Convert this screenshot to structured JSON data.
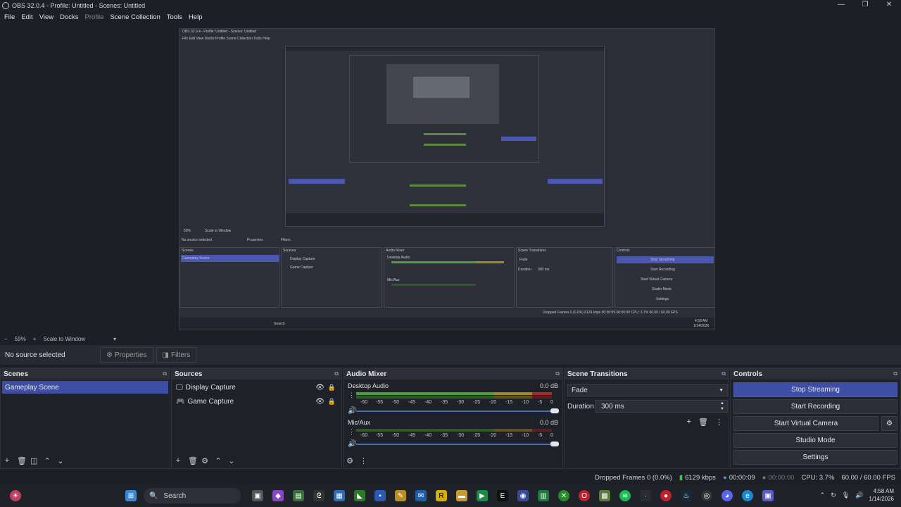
{
  "window": {
    "title": "OBS 32.0.4 - Profile: Untitled - Scenes: Untitled",
    "minimize": "—",
    "maximize": "❐",
    "close": "✕"
  },
  "menu": [
    "File",
    "Edit",
    "View",
    "Docks",
    "Profile",
    "Scene Collection",
    "Tools",
    "Help"
  ],
  "nested_preview": {
    "title": "OBS 32.0.4 - Profile: Untitled - Scenes: Untitled",
    "menu": "File  Edit  View  Docks  Profile  Scene Collection  Tools  Help",
    "zoom": "59%",
    "scale": "Scale to Window",
    "no_source": "No source selected",
    "properties": "Properties",
    "filters": "Filters",
    "scenes": "Scenes",
    "sources": "Sources",
    "audio_mixer": "Audio Mixer",
    "scene_transitions": "Scene Transitions",
    "controls": "Controls",
    "scene_item": "Gameplay Scene",
    "source1": "Display Capture",
    "source2": "Game Capture",
    "desktop_audio": "Desktop Audio",
    "mic": "Mic/Aux",
    "fade": "Fade",
    "duration": "Duration",
    "duration_val": "300 ms",
    "stop_streaming": "Stop Streaming",
    "start_recording": "Start Recording",
    "start_virtual": "Start Virtual Camera",
    "studio": "Studio Mode",
    "settings": "Settings",
    "status": "Dropped Frames 0 (0.0%)   6129 kbps   00:00:09   00:00:00   CPU: 3.7%   60.00 / 60.00 FPS",
    "search": "Search",
    "time": "4:58 AM",
    "date": "1/14/2026"
  },
  "zoombar": {
    "minus": "−",
    "zoom": "59%",
    "plus": "+",
    "scale": "Scale to Window",
    "arrow": "▾"
  },
  "source_toolbar": {
    "no_source": "No source selected",
    "properties": "Properties",
    "filters": "Filters"
  },
  "scenes": {
    "title": "Scenes",
    "items": [
      "Gameplay Scene"
    ]
  },
  "sources": {
    "title": "Sources",
    "items": [
      "Display Capture",
      "Game Capture"
    ]
  },
  "mixer": {
    "title": "Audio Mixer",
    "channels": [
      {
        "name": "Desktop Audio",
        "db": "0.0 dB",
        "level": 0.7
      },
      {
        "name": "Mic/Aux",
        "db": "0.0 dB",
        "level": 0.0
      }
    ],
    "ticks": [
      "-60",
      "-55",
      "-50",
      "-45",
      "-40",
      "-35",
      "-30",
      "-25",
      "-20",
      "-15",
      "-10",
      "-5",
      "0"
    ]
  },
  "transitions": {
    "title": "Scene Transitions",
    "selected": "Fade",
    "duration_label": "Duration",
    "duration_value": "300 ms"
  },
  "controls": {
    "title": "Controls",
    "stop_streaming": "Stop Streaming",
    "start_recording": "Start Recording",
    "start_virtual_camera": "Start Virtual Camera",
    "studio_mode": "Studio Mode",
    "settings": "Settings"
  },
  "status": {
    "dropped_frames": "Dropped Frames 0 (0.0%)",
    "bitrate": "6129 kbps",
    "stream_time": "00:00:09",
    "record_time": "00:00:00",
    "cpu": "CPU: 3.7%",
    "fps": "60.00 / 60.00 FPS"
  },
  "taskbar": {
    "search": "Search",
    "time": "4:58 AM",
    "date": "1/14/2026"
  },
  "colors": {
    "accent": "#3d4ea3",
    "meter_green": "#4a9f3a",
    "meter_yellow": "#a08a20",
    "meter_red": "#a82a2a",
    "status_green": "#43c25c"
  }
}
